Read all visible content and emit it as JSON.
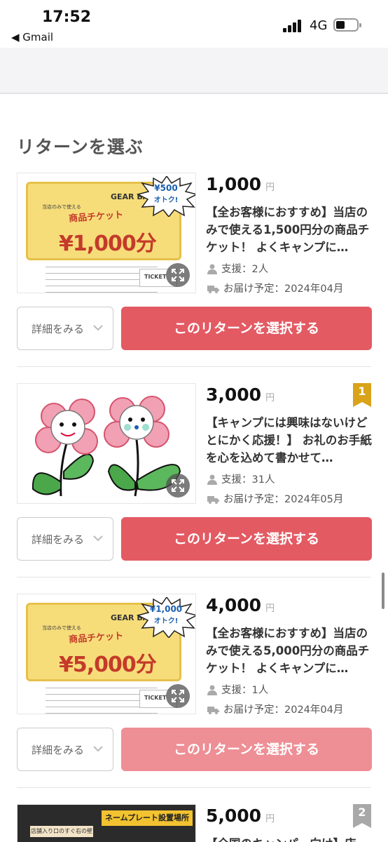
{
  "status_bar": {
    "time": "17:52",
    "back_app": "◀ Gmail",
    "network": "4G"
  },
  "section": {
    "title": "リターンを選ぶ"
  },
  "buttons": {
    "detail_label": "詳細をみる",
    "select_label": "このリターンを選択する"
  },
  "rewards": [
    {
      "price": "1,000",
      "currency": "円",
      "description": "【全お客様におすすめ】当店のみで使える1,500円分の商品チケット！ よくキャンプに…",
      "supporters": "支援：2人",
      "delivery": "お届け予定：2024年04月",
      "image": {
        "brand": "GEAR BASE",
        "small_text": "当店のみで使える",
        "title": "商品チケット",
        "amount": "¥1,000分",
        "burst_top": "¥500",
        "burst_bottom": "オトク!",
        "stub": "TICKET"
      }
    },
    {
      "price": "3,000",
      "currency": "円",
      "rank": "1",
      "description": "【キャンプには興味はないけどとにかく応援！】 お礼のお手紙を心を込めて書かせて…",
      "supporters": "支援：31人",
      "delivery": "お届け予定：2024年05月"
    },
    {
      "price": "4,000",
      "currency": "円",
      "description": "【全お客様におすすめ】当店のみで使える5,000円分の商品チケット！ よくキャンプに…",
      "supporters": "支援：1人",
      "delivery": "お届け予定：2024年04月",
      "image": {
        "brand": "GEAR BASE",
        "small_text": "当店のみで使える",
        "title": "商品チケット",
        "amount": "¥5,000分",
        "burst_top": "¥1,000",
        "burst_bottom": "オトク!",
        "stub": "TICKET"
      }
    },
    {
      "price": "5,000",
      "currency": "円",
      "rank": "2",
      "description": "【全国のキャンパー向け】店…",
      "image": {
        "sign": "ネームプレート設置場所",
        "sign2": "店舗入り口のすぐ右の壁"
      }
    }
  ],
  "colors": {
    "select_button": "#e35a63",
    "select_button_disabled": "#ee8e95",
    "rank_gold": "#d9a31a",
    "rank_silver": "#a8a8a8"
  },
  "icons": [
    "person-icon",
    "truck-icon",
    "expand-icon",
    "chevron-down-icon",
    "rank-badge-icon"
  ]
}
